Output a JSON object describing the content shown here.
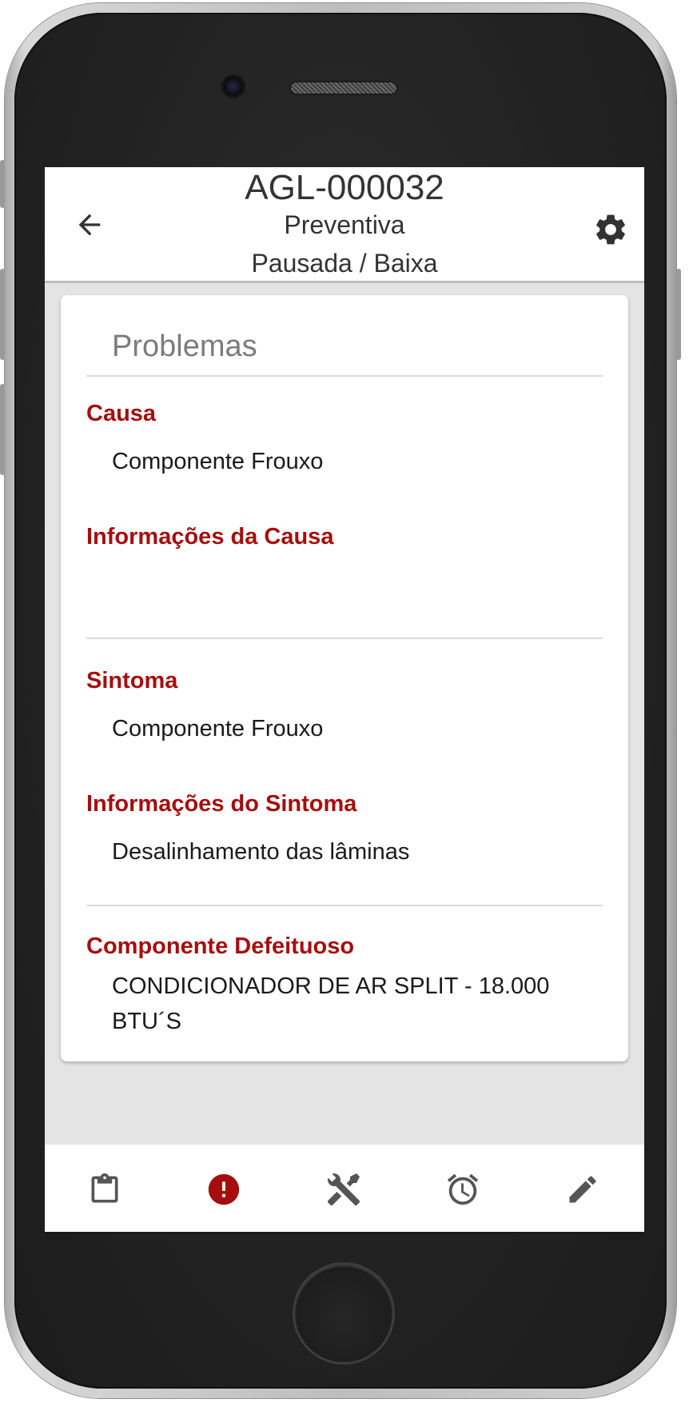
{
  "header": {
    "id": "AGL-000032",
    "type": "Preventiva",
    "status": "Pausada / Baixa"
  },
  "card": {
    "title": "Problemas",
    "fields": [
      {
        "label": "Causa",
        "value": "Componente Frouxo"
      },
      {
        "label": "Informações da Causa",
        "value": ""
      },
      {
        "label": "Sintoma",
        "value": "Componente Frouxo"
      },
      {
        "label": "Informações do Sintoma",
        "value": "Desalinhamento das lâminas"
      },
      {
        "label": "Componente Defeituoso",
        "value": "CONDICIONADOR DE AR SPLIT - 18.000 BTU´S"
      }
    ]
  },
  "bottom_nav": {
    "items": [
      {
        "icon": "clipboard-icon",
        "active": false
      },
      {
        "icon": "alert-circle-icon",
        "active": true
      },
      {
        "icon": "tools-icon",
        "active": false
      },
      {
        "icon": "alarm-clock-icon",
        "active": false
      },
      {
        "icon": "pencil-icon",
        "active": false
      }
    ]
  },
  "colors": {
    "accent": "#a50e0e",
    "icon_default": "#555555",
    "background": "#e4e4e4"
  }
}
